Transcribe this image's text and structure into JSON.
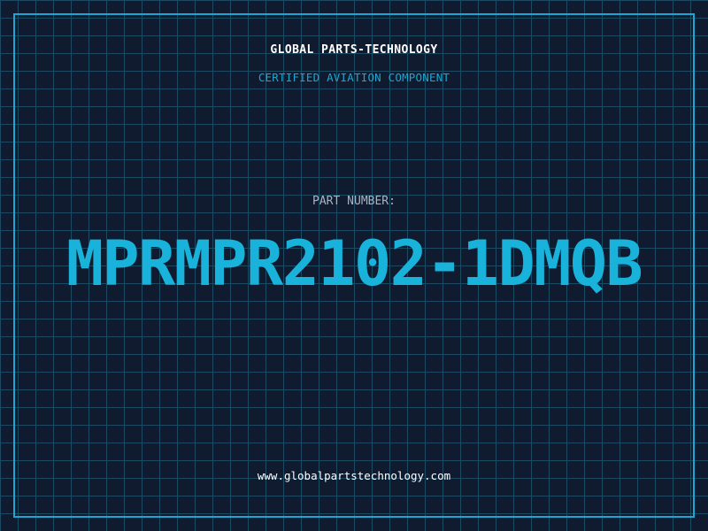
{
  "header": {
    "company": "GLOBAL PARTS-TECHNOLOGY",
    "subtitle": "CERTIFIED AVIATION COMPONENT"
  },
  "part": {
    "label": "PART NUMBER:",
    "number": "MPRMPR2102-1DMQB"
  },
  "footer": {
    "url": "www.globalpartstechnology.com"
  },
  "colors": {
    "background": "#101b2f",
    "grid": "#1b4a63",
    "accent": "#1aa7d2",
    "part_number": "#19b2db",
    "label": "#a8b4c4",
    "text": "#ffffff"
  }
}
